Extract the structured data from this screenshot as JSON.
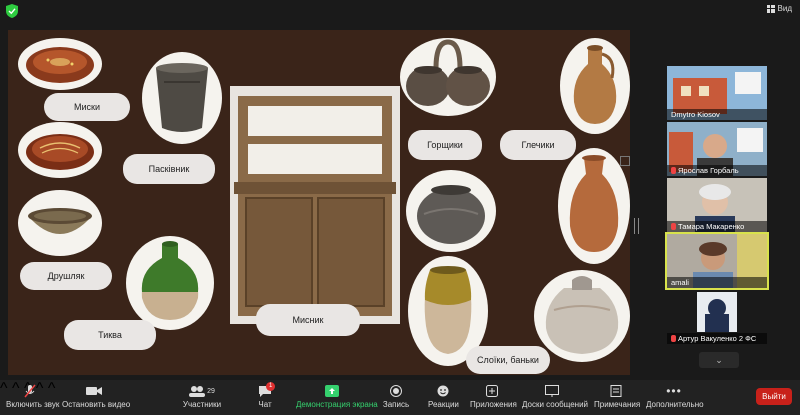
{
  "window": {
    "view_label": "Вид"
  },
  "slide": {
    "labels": {
      "bowls": "Миски",
      "paskivnyk": "Пасківник",
      "colander": "Друшляк",
      "gourd": "Тиква",
      "cupboard": "Мисник",
      "pots": "Горщики",
      "jugs": "Глечики",
      "jars": "Слоїки, баньки"
    }
  },
  "participants": [
    {
      "name": "Dmytro Kiosov",
      "muted": false
    },
    {
      "name": "Ярослав Горбаль",
      "muted": true
    },
    {
      "name": "Тамара Макаренко",
      "muted": true
    },
    {
      "name": "amali",
      "muted": false
    },
    {
      "name": "Артур Вакуленко 2 ФС",
      "muted": true
    }
  ],
  "toolbar": {
    "unmute": "Включить звук",
    "stop_video": "Остановить видео",
    "participants": "Участники",
    "participants_count": "29",
    "chat": "Чат",
    "chat_badge": "1",
    "share": "Демонстрация экрана",
    "record": "Запись",
    "reactions": "Реакции",
    "apps": "Приложения",
    "whiteboards": "Доски сообщений",
    "notes": "Примечания",
    "more": "Дополнительно",
    "leave": "Выйти"
  },
  "colors": {
    "share_green": "#35d16e",
    "leave_red": "#c8211a",
    "slide_bg": "#3a2419",
    "active_speaker": "#d8e24c"
  }
}
